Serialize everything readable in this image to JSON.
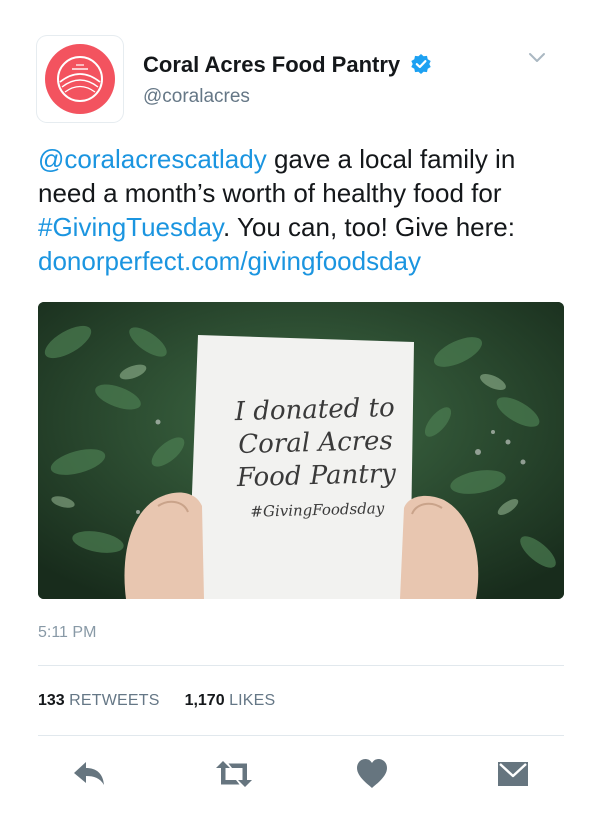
{
  "account": {
    "display_name": "Coral Acres Food Pantry",
    "handle": "@coralacres",
    "verified": true,
    "avatar_color": "#f3535f"
  },
  "tweet": {
    "mention": "@coralacrescatlady",
    "text_1": " gave a local family in need a month’s worth of healthy food for ",
    "hashtag": "#GivingTuesday",
    "text_2": ". You can, too! Give here: ",
    "link": "donorperfect.com/givingfoodsday"
  },
  "media": {
    "sign_line_1": "I donated to",
    "sign_line_2": "Coral Acres",
    "sign_line_3": "Food Pantry",
    "sign_line_4": "#GivingFoodsday"
  },
  "timestamp": "5:11 PM",
  "stats": {
    "retweets_count": "133",
    "retweets_label": "RETWEETS",
    "likes_count": "1,170",
    "likes_label": "LIKES"
  },
  "actions": [
    "reply-icon",
    "retweet-icon",
    "like-icon",
    "direct-message-icon"
  ],
  "colors": {
    "link": "#1b95e0",
    "verified": "#1da1f2",
    "action_icon": "#66757f"
  }
}
